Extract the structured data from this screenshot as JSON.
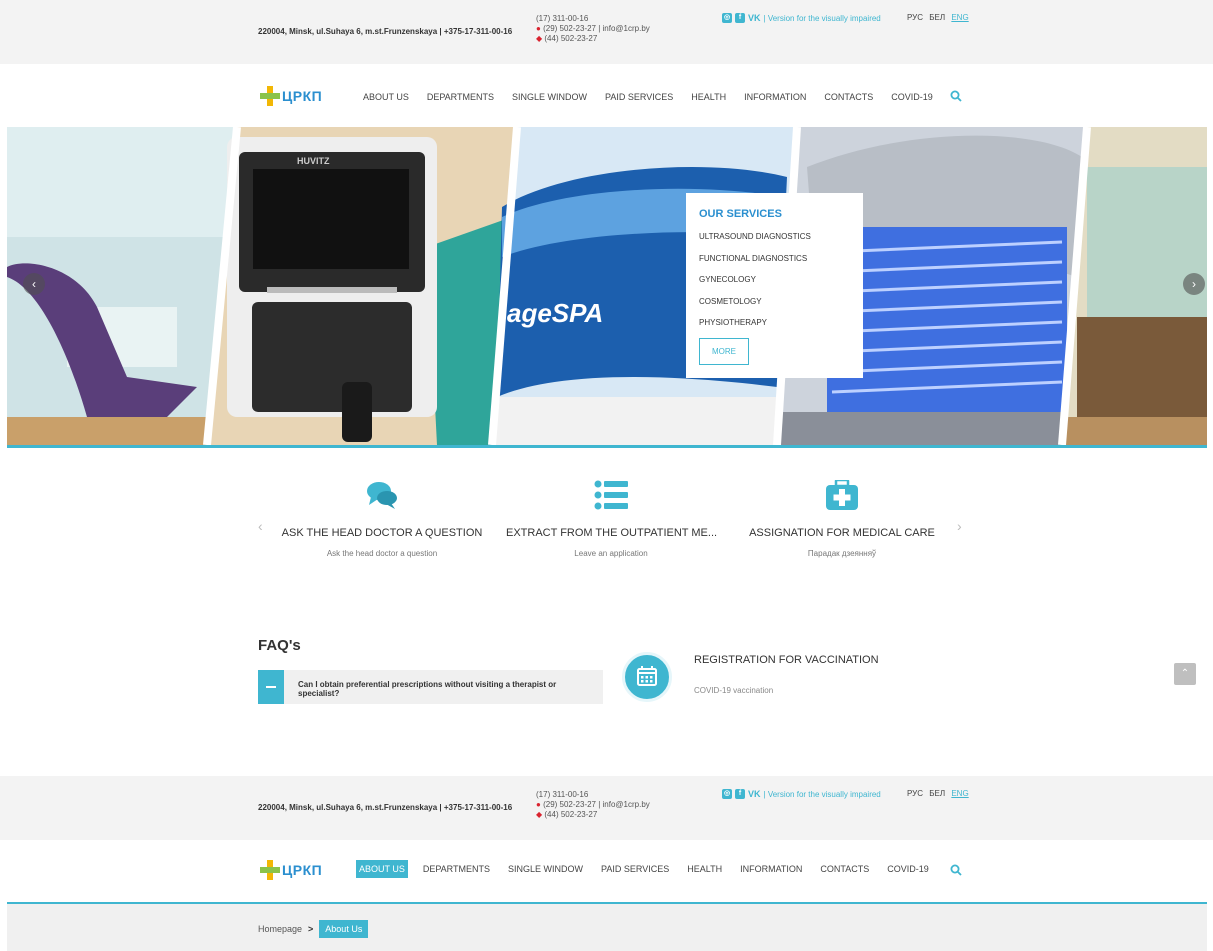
{
  "header": {
    "address": "220004, Minsk, ul.Suhaya 6, m.st.Frunzenskaya | +375-17-311-00-16",
    "phone_top": "(17) 311-00-16",
    "phone_mid": "(29) 502-23-27 | info@1crp.by",
    "phone_bottom": "(44) 502-23-27",
    "visually_impaired": "| Version for the visually impaired",
    "social_vk": "VK",
    "languages": [
      "РУС",
      "БЕЛ",
      "ENG"
    ],
    "active_language": "ENG"
  },
  "brand": {
    "logo_text": "ЦРКП"
  },
  "nav": {
    "items": [
      "ABOUT US",
      "DEPARTMENTS",
      "SINGLE WINDOW",
      "PAID SERVICES",
      "HEALTH",
      "INFORMATION",
      "CONTACTS",
      "COVID-19"
    ]
  },
  "hero": {
    "device_label": "HUVITZ",
    "spa_label": "ageSPA",
    "services_title": "OUR SERVICES",
    "services": [
      "ULTRASOUND DIAGNOSTICS",
      "FUNCTIONAL DIAGNOSTICS",
      "GYNECOLOGY",
      "COSMETOLOGY",
      "PHYSIOTHERAPY"
    ],
    "more_label": "MORE"
  },
  "features": [
    {
      "title": "ASK THE HEAD DOCTOR A QUESTION",
      "subtitle": "Ask the head doctor a question",
      "icon": "chat-bubbles-icon"
    },
    {
      "title": "EXTRACT FROM THE OUTPATIENT ME...",
      "subtitle": "Leave an application",
      "icon": "list-icon"
    },
    {
      "title": "ASSIGNATION FOR MEDICAL CARE",
      "subtitle": "Парадак дзеянняў",
      "icon": "first-aid-kit-icon"
    }
  ],
  "faq": {
    "title": "FAQ's",
    "question": "Can I obtain preferential prescriptions without visiting a therapist or specialist?"
  },
  "vaccination": {
    "title": "REGISTRATION FOR VACCINATION",
    "subtitle": "COVID-19 vaccination"
  },
  "breadcrumb": {
    "home": "Homepage",
    "separator": ">",
    "current": "About Us"
  },
  "colors": {
    "accent": "#3fb6d0",
    "logo_blue": "#2b8fcf",
    "logo_yellow": "#f2b705",
    "logo_green": "#8bc34a"
  }
}
